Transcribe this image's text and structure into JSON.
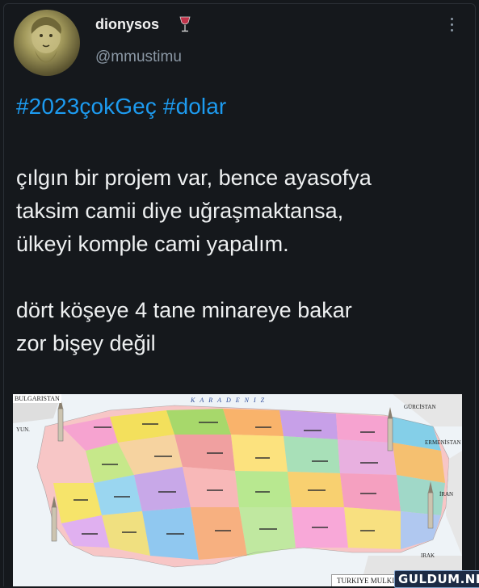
{
  "tweet": {
    "display_name": "dionysos",
    "name_emoji_icon": "wine-glass-icon",
    "handle": "@mmustimu",
    "hashtags": [
      "#2023çokGeç",
      "#dolar"
    ],
    "text": "çılgın bir projem var, bence ayasofya\ntaksim camii diye uğraşmaktansa,\nülkeyi komple cami yapalım.\n\ndört köşeye 4 tane minareye bakar\nzor bişey değil"
  },
  "map": {
    "top_left_label": "BULGARISTAN",
    "sea_label": "KARADENIZ",
    "neighbor_labels": {
      "georgia": "GÜRCİSTAN",
      "armenia": "ERMENİSTAN",
      "iran": "İRAN",
      "iraq": "IRAK",
      "greece": "YUN."
    },
    "caption": "TURKIYE MULKI IDARE"
  },
  "watermark": "GULDUM.NET",
  "colors": {
    "background": "#15181c",
    "link": "#1d9bf0",
    "muted": "#8b98a5"
  }
}
